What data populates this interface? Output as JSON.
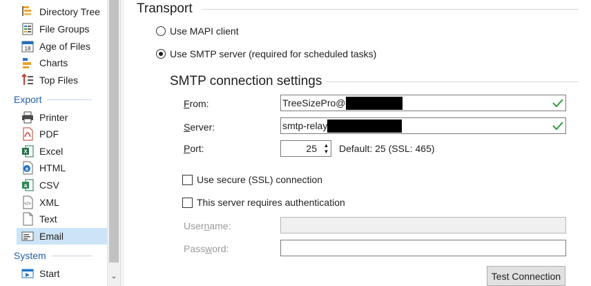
{
  "sidebar": {
    "groups": [
      {
        "label": "",
        "items": [
          {
            "label": "Directory Tree",
            "icon": "directory-tree-icon"
          },
          {
            "label": "File Groups",
            "icon": "file-groups-icon"
          },
          {
            "label": "Age of Files",
            "icon": "calendar-icon",
            "icon_text": "18"
          },
          {
            "label": "Charts",
            "icon": "bar-chart-icon"
          },
          {
            "label": "Top Files",
            "icon": "top-files-icon"
          }
        ]
      },
      {
        "label": "Export",
        "items": [
          {
            "label": "Printer",
            "icon": "printer-icon"
          },
          {
            "label": "PDF",
            "icon": "pdf-icon"
          },
          {
            "label": "Excel",
            "icon": "excel-icon"
          },
          {
            "label": "HTML",
            "icon": "html-icon"
          },
          {
            "label": "CSV",
            "icon": "csv-icon"
          },
          {
            "label": "XML",
            "icon": "xml-icon"
          },
          {
            "label": "Text",
            "icon": "text-file-icon"
          },
          {
            "label": "Email",
            "icon": "email-icon",
            "selected": true
          }
        ]
      },
      {
        "label": "System",
        "items": [
          {
            "label": "Start",
            "icon": "start-icon"
          }
        ]
      }
    ]
  },
  "transport": {
    "heading": "Transport",
    "options": [
      {
        "label": "Use MAPI client",
        "checked": false
      },
      {
        "label": "Use SMTP server (required for scheduled tasks)",
        "checked": true
      }
    ]
  },
  "smtp": {
    "heading": "SMTP connection settings",
    "from": {
      "label_accel": "F",
      "label_rest": "rom:",
      "value": "TreeSizePro@",
      "valid": true
    },
    "server": {
      "label_accel": "S",
      "label_rest": "erver:",
      "value": "smtp-relay",
      "valid": true
    },
    "port": {
      "label_accel": "P",
      "label_rest": "ort:",
      "value": "25",
      "default_text": "Default: 25 (SSL: 465)"
    },
    "ssl": {
      "label": "Use secure (SSL) connection",
      "checked": false
    },
    "auth": {
      "label": "This server requires authentication",
      "checked": false
    },
    "username": {
      "label_pre": "User",
      "label_accel": "n",
      "label_rest": "ame:",
      "value": "",
      "disabled": true
    },
    "password": {
      "label_pre": "Pass",
      "label_accel": "w",
      "label_rest": "ord:",
      "value": "",
      "disabled": false
    },
    "test_button": "Test Connection"
  },
  "colors": {
    "selection": "#cce4f7",
    "group_label": "#1f5fa8",
    "valid_check": "#2e9d3a",
    "redaction": "#000000"
  }
}
